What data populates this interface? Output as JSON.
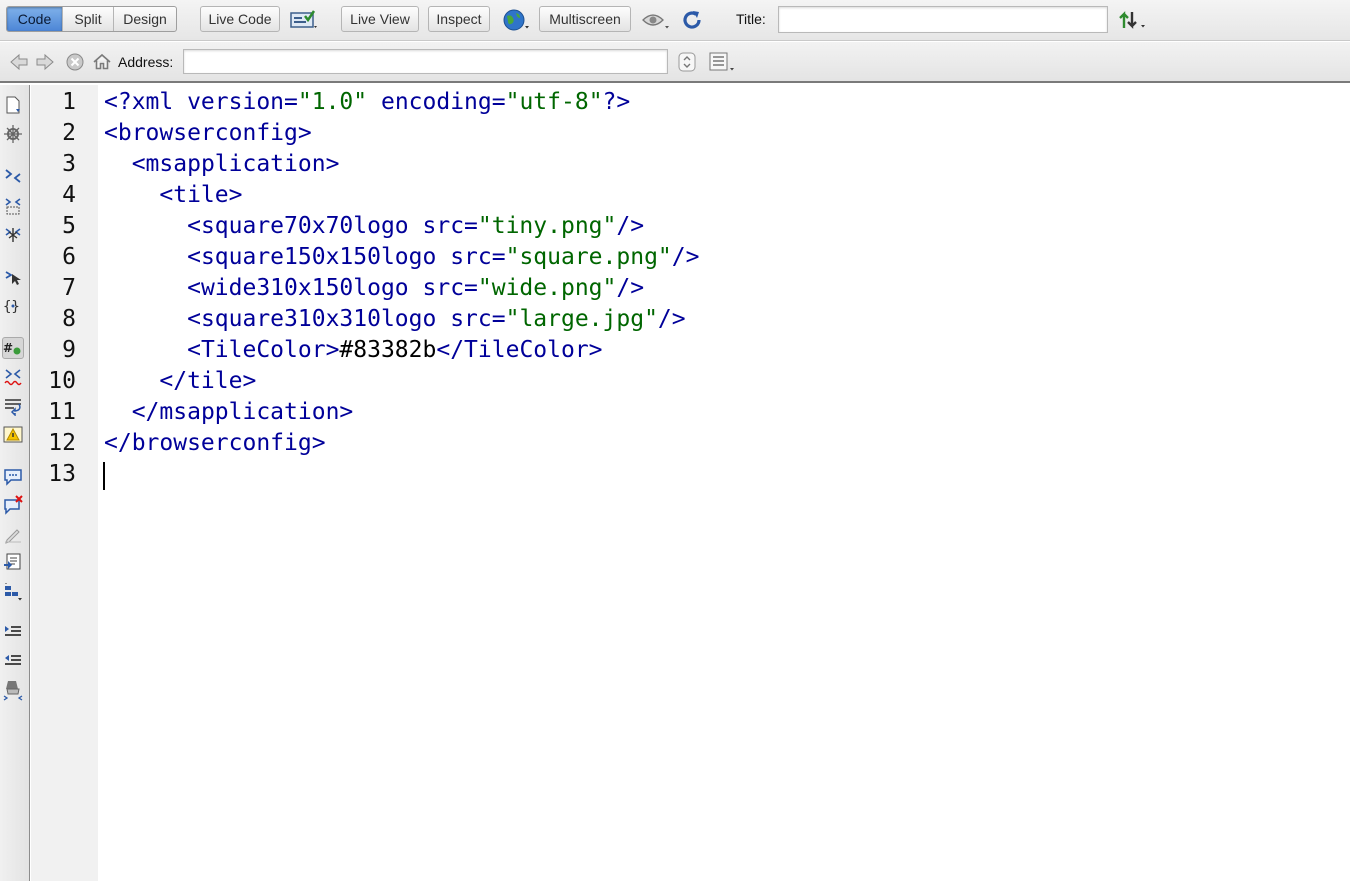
{
  "toolbar": {
    "view_modes": [
      {
        "label": "Code",
        "active": true
      },
      {
        "label": "Split",
        "active": false
      },
      {
        "label": "Design",
        "active": false
      }
    ],
    "live_code_label": "Live Code",
    "live_view_label": "Live View",
    "inspect_label": "Inspect",
    "multiscreen_label": "Multiscreen",
    "title_label": "Title:",
    "title_value": ""
  },
  "address_bar": {
    "address_label": "Address:",
    "address_value": ""
  },
  "editor": {
    "lines": [
      {
        "number": "1",
        "indent": "",
        "parts": [
          {
            "t": "<?xml version=",
            "c": "tag"
          },
          {
            "t": "\"1.0\"",
            "c": "str"
          },
          {
            "t": " encoding=",
            "c": "tag"
          },
          {
            "t": "\"utf-8\"",
            "c": "str"
          },
          {
            "t": "?>",
            "c": "tag"
          }
        ]
      },
      {
        "number": "2",
        "indent": "",
        "parts": [
          {
            "t": "<browserconfig>",
            "c": "tag"
          }
        ]
      },
      {
        "number": "3",
        "indent": "  ",
        "parts": [
          {
            "t": "<msapplication>",
            "c": "tag"
          }
        ]
      },
      {
        "number": "4",
        "indent": "    ",
        "parts": [
          {
            "t": "<tile>",
            "c": "tag"
          }
        ]
      },
      {
        "number": "5",
        "indent": "      ",
        "parts": [
          {
            "t": "<square70x70logo src=",
            "c": "tag"
          },
          {
            "t": "\"tiny.png\"",
            "c": "str"
          },
          {
            "t": "/>",
            "c": "tag"
          }
        ]
      },
      {
        "number": "6",
        "indent": "      ",
        "parts": [
          {
            "t": "<square150x150logo src=",
            "c": "tag"
          },
          {
            "t": "\"square.png\"",
            "c": "str"
          },
          {
            "t": "/>",
            "c": "tag"
          }
        ]
      },
      {
        "number": "7",
        "indent": "      ",
        "parts": [
          {
            "t": "<wide310x150logo src=",
            "c": "tag"
          },
          {
            "t": "\"wide.png\"",
            "c": "str"
          },
          {
            "t": "/>",
            "c": "tag"
          }
        ]
      },
      {
        "number": "8",
        "indent": "      ",
        "parts": [
          {
            "t": "<square310x310logo src=",
            "c": "tag"
          },
          {
            "t": "\"large.jpg\"",
            "c": "str"
          },
          {
            "t": "/>",
            "c": "tag"
          }
        ]
      },
      {
        "number": "9",
        "indent": "      ",
        "parts": [
          {
            "t": "<TileColor>",
            "c": "tag"
          },
          {
            "t": "#83382b",
            "c": "txt"
          },
          {
            "t": "</TileColor>",
            "c": "tag"
          }
        ]
      },
      {
        "number": "10",
        "indent": "    ",
        "parts": [
          {
            "t": "</tile>",
            "c": "tag"
          }
        ]
      },
      {
        "number": "11",
        "indent": "  ",
        "parts": [
          {
            "t": "</msapplication>",
            "c": "tag"
          }
        ]
      },
      {
        "number": "12",
        "indent": "",
        "parts": [
          {
            "t": "</browserconfig>",
            "c": "tag"
          }
        ]
      },
      {
        "number": "13",
        "indent": "",
        "parts": []
      }
    ]
  },
  "colors": {
    "tag": "#000099",
    "string": "#006600",
    "text": "#000000",
    "active_button": "#5a92dc"
  },
  "icons": {
    "toolbar": [
      "file-management-icon",
      "globe-preview-icon",
      "visual-aids-icon",
      "refresh-icon",
      "sort-arrows-icon"
    ],
    "address_bar": [
      "back-arrow-icon",
      "forward-arrow-icon",
      "stop-icon",
      "home-icon",
      "stepper-icon",
      "options-list-icon"
    ],
    "coding_toolbar": [
      "open-documents-icon",
      "show-code-navigator-icon",
      "collapse-full-tag-icon",
      "collapse-selection-icon",
      "expand-all-icon",
      "select-parent-tag-icon",
      "balance-braces-icon",
      "line-numbers-icon",
      "highlight-invalid-code-icon",
      "word-wrap-icon",
      "syntax-error-alerts-icon",
      "apply-comment-icon",
      "remove-comment-icon",
      "wrap-tag-icon",
      "recent-snippets-icon",
      "move-css-icon",
      "indent-code-icon",
      "outdent-code-icon",
      "format-source-code-icon"
    ]
  }
}
